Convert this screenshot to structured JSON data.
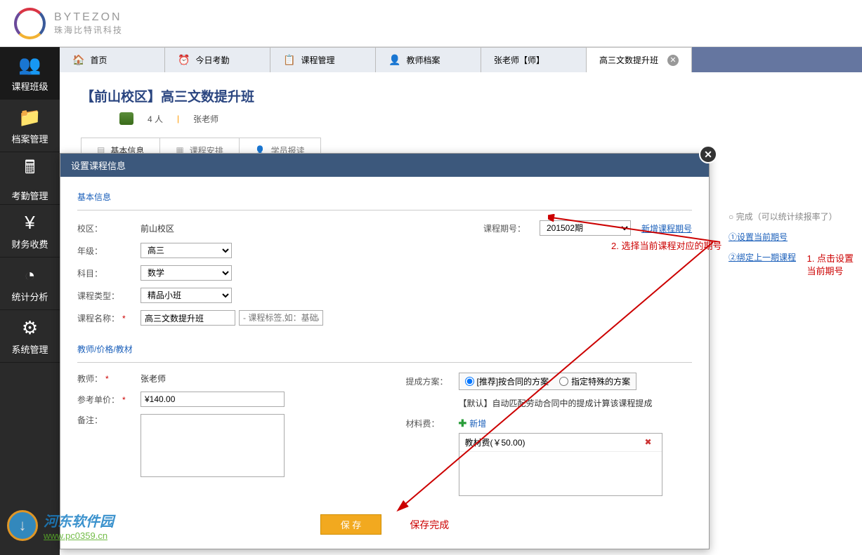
{
  "brand": {
    "en": "BYTEZON",
    "cn": "珠海比特讯科技"
  },
  "sidebar": {
    "items": [
      {
        "label": "课程班级",
        "icon": "👥"
      },
      {
        "label": "档案管理",
        "icon": "📁"
      },
      {
        "label": "考勤管理",
        "icon": "🖩"
      },
      {
        "label": "财务收费",
        "icon": "¥"
      },
      {
        "label": "统计分析",
        "icon": "◔"
      },
      {
        "label": "系统管理",
        "icon": "⚙"
      }
    ]
  },
  "tabs": [
    {
      "label": "首页",
      "icon": "🏠"
    },
    {
      "label": "今日考勤",
      "icon": "⏰"
    },
    {
      "label": "课程管理",
      "icon": "📋"
    },
    {
      "label": "教师档案",
      "icon": "👤"
    },
    {
      "label": "张老师【师】"
    },
    {
      "label": "高三文数提升班",
      "active": true
    }
  ],
  "page": {
    "title": "【前山校区】高三文数提升班",
    "people": "4 人",
    "teacher": "张老师",
    "subTabs": [
      "基本信息",
      "课程安排",
      "学员报读"
    ]
  },
  "rightPanel": {
    "header": "完成（可以统计续报率了）",
    "links": [
      "①设置当前期号",
      "②绑定上一期课程"
    ]
  },
  "modal": {
    "title": "设置课程信息",
    "section1": {
      "title": "基本信息",
      "campusLabel": "校区：",
      "campus": "前山校区",
      "termLabel": "课程期号：",
      "termValue": "201502期",
      "addTermLink": "新增课程期号",
      "gradeLabel": "年级：",
      "gradeValue": "高三",
      "subjectLabel": "科目：",
      "subjectValue": "数学",
      "typeLabel": "课程类型：",
      "typeValue": "精品小班",
      "nameLabel": "课程名称：",
      "nameValue": "高三文数提升班",
      "nameHint": "- 课程标签,如：基础/培"
    },
    "section2": {
      "title": "教师/价格/教材",
      "teacherLabel": "教师：",
      "teacherValue": "张老师",
      "schemeLabel": "提成方案：",
      "schemeOpt1": "[推荐]按合同的方案",
      "schemeOpt2": "指定特殊的方案",
      "schemeNote": "【默认】自动匹配劳动合同中的提成计算该课程提成",
      "priceLabel": "参考单价：",
      "priceValue": "¥140.00",
      "materialLabel": "材料费：",
      "materialAdd": "新增",
      "materialItem": "教材费(￥50.00)",
      "remarkLabel": "备注："
    },
    "saveBtn": "保 存",
    "saveStatus": "保存完成"
  },
  "annotations": {
    "a1": "1. 点击设置\n当前期号",
    "a2": "2. 选择当前课程对应的期号"
  },
  "watermark": {
    "cn": "河东软件园",
    "url": "www.pc0359.cn"
  }
}
